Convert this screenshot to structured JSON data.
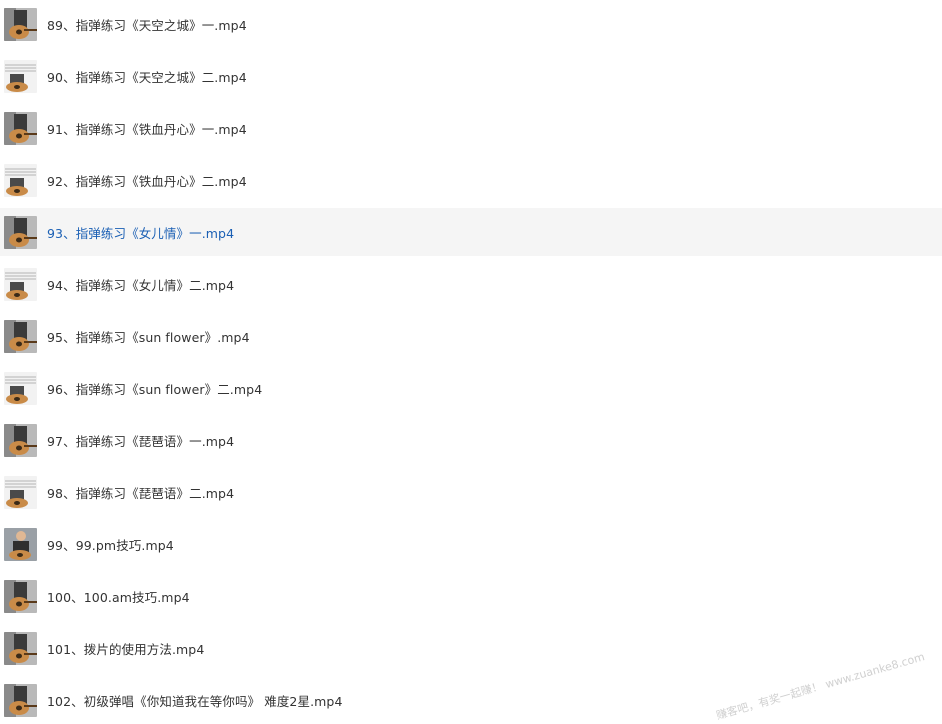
{
  "files": [
    {
      "name": "89、指弹练习《天空之城》一.mp4",
      "thumb": "guitar-dark"
    },
    {
      "name": "90、指弹练习《天空之城》二.mp4",
      "thumb": "sheet-guitar"
    },
    {
      "name": "91、指弹练习《铁血丹心》一.mp4",
      "thumb": "guitar-dark"
    },
    {
      "name": "92、指弹练习《铁血丹心》二.mp4",
      "thumb": "sheet-guitar"
    },
    {
      "name": "93、指弹练习《女儿情》一.mp4",
      "thumb": "guitar-dark"
    },
    {
      "name": "94、指弹练习《女儿情》二.mp4",
      "thumb": "sheet-guitar"
    },
    {
      "name": "95、指弹练习《sun flower》.mp4",
      "thumb": "guitar-dark"
    },
    {
      "name": "96、指弹练习《sun flower》二.mp4",
      "thumb": "sheet-guitar"
    },
    {
      "name": "97、指弹练习《琵琶语》一.mp4",
      "thumb": "guitar-dark"
    },
    {
      "name": "98、指弹练习《琵琶语》二.mp4",
      "thumb": "sheet-guitar"
    },
    {
      "name": "99、99.pm技巧.mp4",
      "thumb": "person-guitar"
    },
    {
      "name": "100、100.am技巧.mp4",
      "thumb": "guitar-dark"
    },
    {
      "name": "101、拨片的使用方法.mp4",
      "thumb": "guitar-dark"
    },
    {
      "name": "102、初级弹唱《你知道我在等你吗》 难度2星.mp4",
      "thumb": "guitar-dark"
    }
  ],
  "hovered_index": 4,
  "watermark": "赚客吧，有奖一起赚！ www.zuanke8.com",
  "colors": {
    "text": "#333333",
    "hover_text": "#1a5fb4",
    "hover_bg": "#f5f5f5"
  }
}
